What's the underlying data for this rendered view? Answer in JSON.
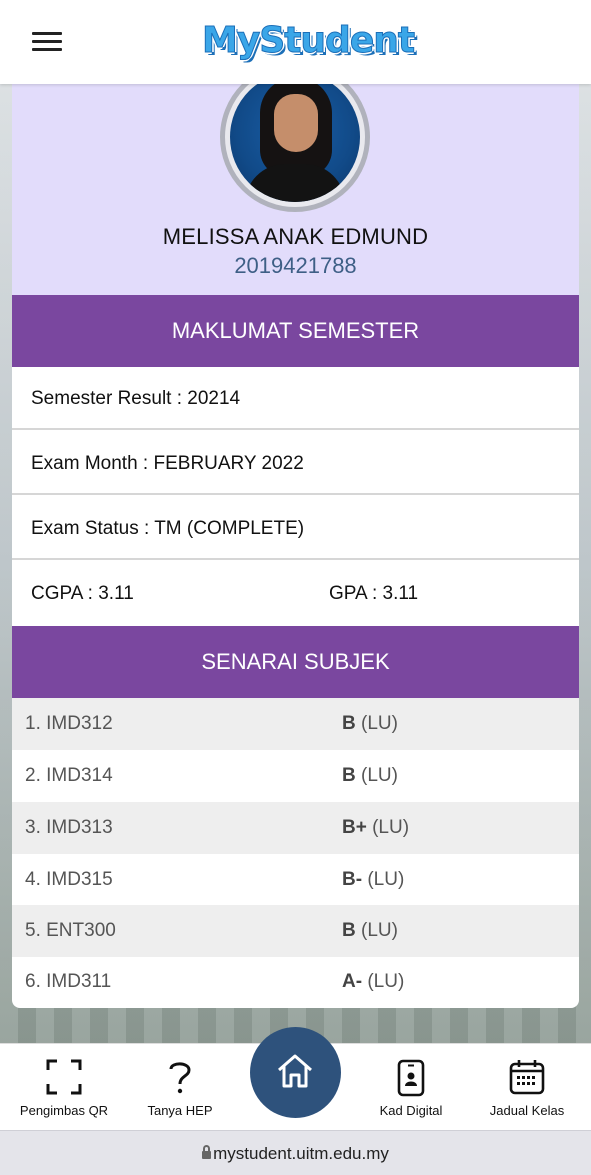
{
  "app": {
    "logo_text": "MyStudent"
  },
  "profile": {
    "name": "MELISSA ANAK EDMUND",
    "student_id": "2019421788"
  },
  "semester": {
    "heading": "MAKLUMAT SEMESTER",
    "result": "Semester Result : 20214",
    "exam_month": "Exam Month : FEBRUARY 2022",
    "exam_status": "Exam Status : TM (COMPLETE)",
    "cgpa": "CGPA : 3.11",
    "gpa": "GPA : 3.11"
  },
  "subjects": {
    "heading": "SENARAI SUBJEK",
    "items": [
      {
        "code": "1. IMD312",
        "grade": "B",
        "note": "(LU)"
      },
      {
        "code": "2. IMD314",
        "grade": "B",
        "note": "(LU)"
      },
      {
        "code": "3. IMD313",
        "grade": "B+",
        "note": "(LU)"
      },
      {
        "code": "4. IMD315",
        "grade": "B-",
        "note": "(LU)"
      },
      {
        "code": "5. ENT300",
        "grade": "B",
        "note": "(LU)"
      },
      {
        "code": "6. IMD311",
        "grade": "A-",
        "note": "(LU)"
      }
    ]
  },
  "bottom_nav": {
    "qr": "Pengimbas QR",
    "help": "Tanya HEP",
    "home_icon": "home-icon",
    "card": "Kad Digital",
    "schedule": "Jadual Kelas"
  },
  "browser": {
    "url": "mystudent.uitm.edu.my"
  },
  "colors": {
    "section_header": "#7a479f",
    "profile_bg": "#e2dcfb",
    "student_id": "#3e5f86",
    "home_button": "#2e527c"
  }
}
